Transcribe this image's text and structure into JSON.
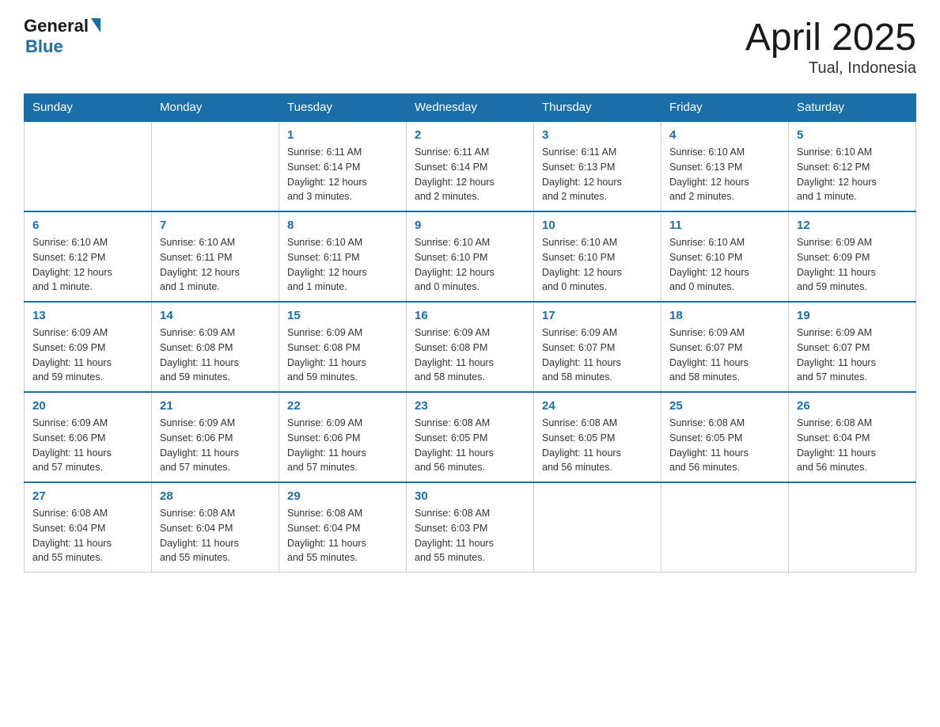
{
  "header": {
    "logo_general": "General",
    "logo_blue": "Blue",
    "month_title": "April 2025",
    "location": "Tual, Indonesia"
  },
  "days_of_week": [
    "Sunday",
    "Monday",
    "Tuesday",
    "Wednesday",
    "Thursday",
    "Friday",
    "Saturday"
  ],
  "weeks": [
    [
      {
        "day": "",
        "info": ""
      },
      {
        "day": "",
        "info": ""
      },
      {
        "day": "1",
        "info": "Sunrise: 6:11 AM\nSunset: 6:14 PM\nDaylight: 12 hours\nand 3 minutes."
      },
      {
        "day": "2",
        "info": "Sunrise: 6:11 AM\nSunset: 6:14 PM\nDaylight: 12 hours\nand 2 minutes."
      },
      {
        "day": "3",
        "info": "Sunrise: 6:11 AM\nSunset: 6:13 PM\nDaylight: 12 hours\nand 2 minutes."
      },
      {
        "day": "4",
        "info": "Sunrise: 6:10 AM\nSunset: 6:13 PM\nDaylight: 12 hours\nand 2 minutes."
      },
      {
        "day": "5",
        "info": "Sunrise: 6:10 AM\nSunset: 6:12 PM\nDaylight: 12 hours\nand 1 minute."
      }
    ],
    [
      {
        "day": "6",
        "info": "Sunrise: 6:10 AM\nSunset: 6:12 PM\nDaylight: 12 hours\nand 1 minute."
      },
      {
        "day": "7",
        "info": "Sunrise: 6:10 AM\nSunset: 6:11 PM\nDaylight: 12 hours\nand 1 minute."
      },
      {
        "day": "8",
        "info": "Sunrise: 6:10 AM\nSunset: 6:11 PM\nDaylight: 12 hours\nand 1 minute."
      },
      {
        "day": "9",
        "info": "Sunrise: 6:10 AM\nSunset: 6:10 PM\nDaylight: 12 hours\nand 0 minutes."
      },
      {
        "day": "10",
        "info": "Sunrise: 6:10 AM\nSunset: 6:10 PM\nDaylight: 12 hours\nand 0 minutes."
      },
      {
        "day": "11",
        "info": "Sunrise: 6:10 AM\nSunset: 6:10 PM\nDaylight: 12 hours\nand 0 minutes."
      },
      {
        "day": "12",
        "info": "Sunrise: 6:09 AM\nSunset: 6:09 PM\nDaylight: 11 hours\nand 59 minutes."
      }
    ],
    [
      {
        "day": "13",
        "info": "Sunrise: 6:09 AM\nSunset: 6:09 PM\nDaylight: 11 hours\nand 59 minutes."
      },
      {
        "day": "14",
        "info": "Sunrise: 6:09 AM\nSunset: 6:08 PM\nDaylight: 11 hours\nand 59 minutes."
      },
      {
        "day": "15",
        "info": "Sunrise: 6:09 AM\nSunset: 6:08 PM\nDaylight: 11 hours\nand 59 minutes."
      },
      {
        "day": "16",
        "info": "Sunrise: 6:09 AM\nSunset: 6:08 PM\nDaylight: 11 hours\nand 58 minutes."
      },
      {
        "day": "17",
        "info": "Sunrise: 6:09 AM\nSunset: 6:07 PM\nDaylight: 11 hours\nand 58 minutes."
      },
      {
        "day": "18",
        "info": "Sunrise: 6:09 AM\nSunset: 6:07 PM\nDaylight: 11 hours\nand 58 minutes."
      },
      {
        "day": "19",
        "info": "Sunrise: 6:09 AM\nSunset: 6:07 PM\nDaylight: 11 hours\nand 57 minutes."
      }
    ],
    [
      {
        "day": "20",
        "info": "Sunrise: 6:09 AM\nSunset: 6:06 PM\nDaylight: 11 hours\nand 57 minutes."
      },
      {
        "day": "21",
        "info": "Sunrise: 6:09 AM\nSunset: 6:06 PM\nDaylight: 11 hours\nand 57 minutes."
      },
      {
        "day": "22",
        "info": "Sunrise: 6:09 AM\nSunset: 6:06 PM\nDaylight: 11 hours\nand 57 minutes."
      },
      {
        "day": "23",
        "info": "Sunrise: 6:08 AM\nSunset: 6:05 PM\nDaylight: 11 hours\nand 56 minutes."
      },
      {
        "day": "24",
        "info": "Sunrise: 6:08 AM\nSunset: 6:05 PM\nDaylight: 11 hours\nand 56 minutes."
      },
      {
        "day": "25",
        "info": "Sunrise: 6:08 AM\nSunset: 6:05 PM\nDaylight: 11 hours\nand 56 minutes."
      },
      {
        "day": "26",
        "info": "Sunrise: 6:08 AM\nSunset: 6:04 PM\nDaylight: 11 hours\nand 56 minutes."
      }
    ],
    [
      {
        "day": "27",
        "info": "Sunrise: 6:08 AM\nSunset: 6:04 PM\nDaylight: 11 hours\nand 55 minutes."
      },
      {
        "day": "28",
        "info": "Sunrise: 6:08 AM\nSunset: 6:04 PM\nDaylight: 11 hours\nand 55 minutes."
      },
      {
        "day": "29",
        "info": "Sunrise: 6:08 AM\nSunset: 6:04 PM\nDaylight: 11 hours\nand 55 minutes."
      },
      {
        "day": "30",
        "info": "Sunrise: 6:08 AM\nSunset: 6:03 PM\nDaylight: 11 hours\nand 55 minutes."
      },
      {
        "day": "",
        "info": ""
      },
      {
        "day": "",
        "info": ""
      },
      {
        "day": "",
        "info": ""
      }
    ]
  ]
}
